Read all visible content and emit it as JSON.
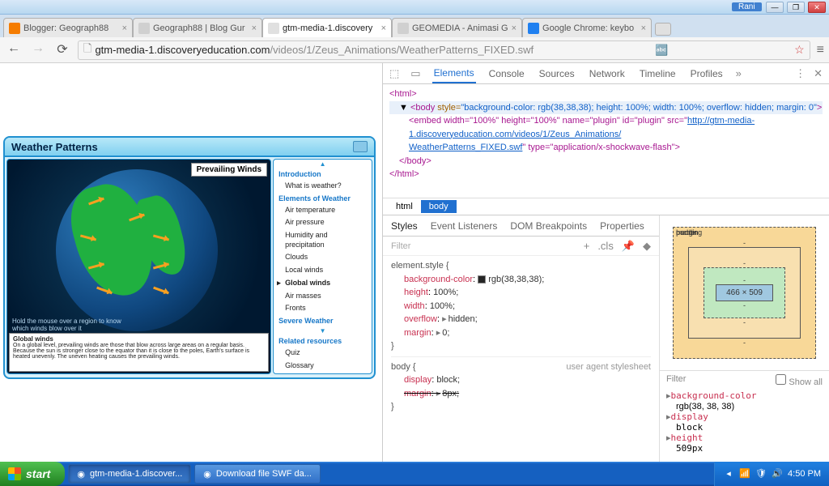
{
  "window": {
    "user": "Rani",
    "min": "—",
    "max": "❐",
    "close": "✕"
  },
  "tabs": [
    {
      "label": "Blogger: Geograph88",
      "fav": "#f57c00"
    },
    {
      "label": "Geograph88 | Blog Gur",
      "fav": "#d0d0d0"
    },
    {
      "label": "gtm-media-1.discovery",
      "fav": "#e0e0e0",
      "active": true
    },
    {
      "label": "GEOMEDIA - Animasi G",
      "fav": "#d0d0d0"
    },
    {
      "label": "Google Chrome: keybo",
      "fav": "#2080f0"
    }
  ],
  "nav": {
    "back": "←",
    "fwd": "→",
    "reload": "⟳",
    "menu": "≡"
  },
  "url": {
    "host": "gtm-media-1.discoveryeducation.com",
    "path": "/videos/1/Zeus_Animations/WeatherPatterns_FIXED.swf",
    "star": "☆"
  },
  "wp": {
    "title": "Weather Patterns",
    "globe_label": "Prevailing Winds",
    "hint": "Hold the mouse over a region to know which winds blow over it",
    "desc_title": "Global winds",
    "desc_body": "On a global level, prevailing winds are those that blow across large areas on a regular basis. Because the sun is stronger close to the equator than it is close to the poles, Earth's surface is heated unevenly. The uneven heating causes the prevailing winds.",
    "sections": {
      "intro": "Introduction",
      "intro_items": [
        "What is weather?"
      ],
      "elements": "Elements of Weather",
      "elements_items": [
        "Air temperature",
        "Air pressure",
        "Humidity and precipitation",
        "Clouds",
        "Local winds",
        "Global winds",
        "Air masses",
        "Fronts"
      ],
      "severe": "Severe Weather",
      "related": "Related resources",
      "related_items": [
        "Quiz",
        "Glossary"
      ]
    }
  },
  "devtools": {
    "tabs": [
      "Elements",
      "Console",
      "Sources",
      "Network",
      "Timeline",
      "Profiles"
    ],
    "active_tab": "Elements",
    "more": "»",
    "dots": "⋮",
    "close": "✕",
    "elements": {
      "l1": "<html>",
      "body_open": "<body",
      "body_style_attr": " style=",
      "body_style_val": "\"background-color: rgb(38,38,38); height: 100%; width: 100%; overflow: hidden; margin: 0\"",
      "body_close": ">",
      "embed": "<embed width=\"100%\" height=\"100%\" name=\"plugin\" id=\"plugin\" src=\"",
      "embed_url1": "http://gtm-media-1.discoveryeducation.com/videos/1/Zeus_Animations/",
      "embed_url2": "WeatherPatterns_FIXED.swf",
      "embed_tail": "\" type=\"application/x-shockwave-flash\">",
      "body_end": "</body>",
      "html_end": "</html>"
    },
    "crumbs": [
      "html",
      "body"
    ],
    "subtabs": [
      "Styles",
      "Event Listeners",
      "DOM Breakpoints",
      "Properties"
    ],
    "filter": "Filter",
    "filter_icons": {
      "plus": "+",
      "cls": ".cls",
      "pin": "📌",
      "hov": "◆"
    },
    "css": {
      "rule1_sel": "element.style {",
      "p1": "background-color",
      "v1": "rgb(38,38,38);",
      "p2": "height",
      "v2": "100%;",
      "p3": "width",
      "v3": "100%;",
      "p4": "overflow",
      "v4": "hidden;",
      "p5": "margin",
      "v5": "0;",
      "rule1_end": "}",
      "rule2_sel": "body {",
      "rule2_ua": "user agent stylesheet",
      "p6": "display",
      "v6": "block;",
      "p7": "margin",
      "v7": "8px;",
      "rule2_end": "}"
    },
    "box": {
      "margin": "margin",
      "mval": "-",
      "border": "border",
      "bval": "-",
      "padding": "padding",
      "pval": "-",
      "content": "466 × 509"
    },
    "computed": {
      "filter": "Filter",
      "showall": "Show all",
      "p1": "background-color",
      "v1": "rgb(38, 38, 38)",
      "p2": "display",
      "v2": "block",
      "p3": "height",
      "v3": "509px"
    }
  },
  "taskbar": {
    "start": "start",
    "btn1": "gtm-media-1.discover...",
    "btn2": "Download file SWF da...",
    "time": "4:50 PM"
  }
}
